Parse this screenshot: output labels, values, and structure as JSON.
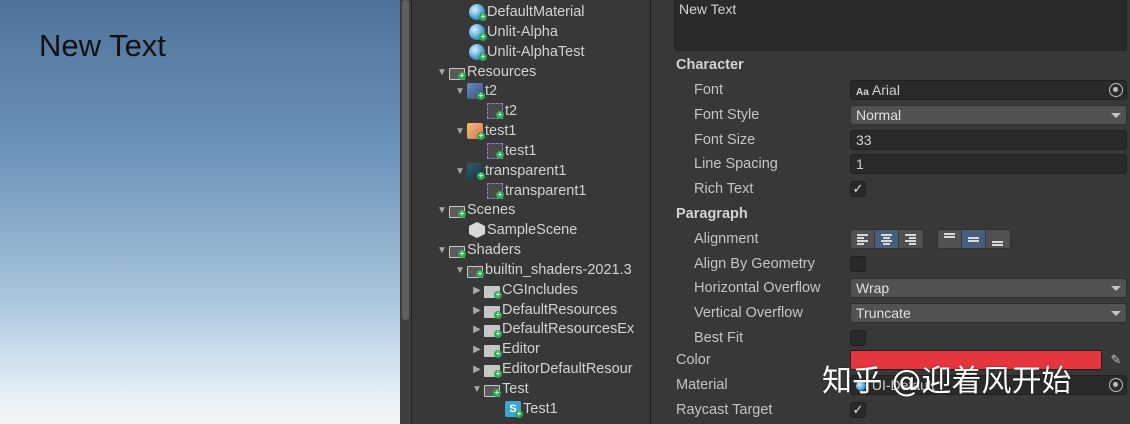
{
  "scene": {
    "text": "New Text"
  },
  "tree": {
    "items": [
      {
        "label": "DefaultMaterial",
        "icon": "material-icon"
      },
      {
        "label": "Unlit-Alpha",
        "icon": "material-icon"
      },
      {
        "label": "Unlit-AlphaTest",
        "icon": "material-icon"
      },
      {
        "label": "Resources",
        "icon": "folder-open-icon"
      },
      {
        "label": "t2",
        "icon": "texture-icon"
      },
      {
        "label": "t2",
        "icon": "sprite-icon"
      },
      {
        "label": "test1",
        "icon": "texture-icon"
      },
      {
        "label": "test1",
        "icon": "sprite-icon"
      },
      {
        "label": "transparent1",
        "icon": "texture-icon"
      },
      {
        "label": "transparent1",
        "icon": "sprite-icon"
      },
      {
        "label": "Scenes",
        "icon": "folder-open-icon"
      },
      {
        "label": "SampleScene",
        "icon": "scene-icon"
      },
      {
        "label": "Shaders",
        "icon": "folder-open-icon"
      },
      {
        "label": "builtin_shaders-2021.3",
        "icon": "folder-open-icon"
      },
      {
        "label": "CGIncludes",
        "icon": "folder-icon"
      },
      {
        "label": "DefaultResources",
        "icon": "folder-icon"
      },
      {
        "label": "DefaultResourcesEx",
        "icon": "folder-icon"
      },
      {
        "label": "Editor",
        "icon": "folder-icon"
      },
      {
        "label": "EditorDefaultResour",
        "icon": "folder-icon"
      },
      {
        "label": "Test",
        "icon": "folder-open-icon"
      },
      {
        "label": "Test1",
        "icon": "shader-icon"
      }
    ]
  },
  "inspector": {
    "text_value": "New Text",
    "character_header": "Character",
    "font_label": "Font",
    "font_value": "Arial",
    "font_icon_text": "Aa",
    "font_style_label": "Font Style",
    "font_style_value": "Normal",
    "font_size_label": "Font Size",
    "font_size_value": "33",
    "line_spacing_label": "Line Spacing",
    "line_spacing_value": "1",
    "rich_text_label": "Rich Text",
    "rich_text_checked": "✓",
    "paragraph_header": "Paragraph",
    "alignment_label": "Alignment",
    "align_by_geometry_label": "Align By Geometry",
    "horizontal_overflow_label": "Horizontal Overflow",
    "horizontal_overflow_value": "Wrap",
    "vertical_overflow_label": "Vertical Overflow",
    "vertical_overflow_value": "Truncate",
    "best_fit_label": "Best Fit",
    "color_label": "Color",
    "color_value": "#E6363D",
    "material_label": "Material",
    "material_value": "UI-Default",
    "raycast_target_label": "Raycast Target",
    "raycast_target_checked": "✓",
    "eyedropper_glyph": "✎"
  },
  "watermark": "知乎 @迎着风开始"
}
